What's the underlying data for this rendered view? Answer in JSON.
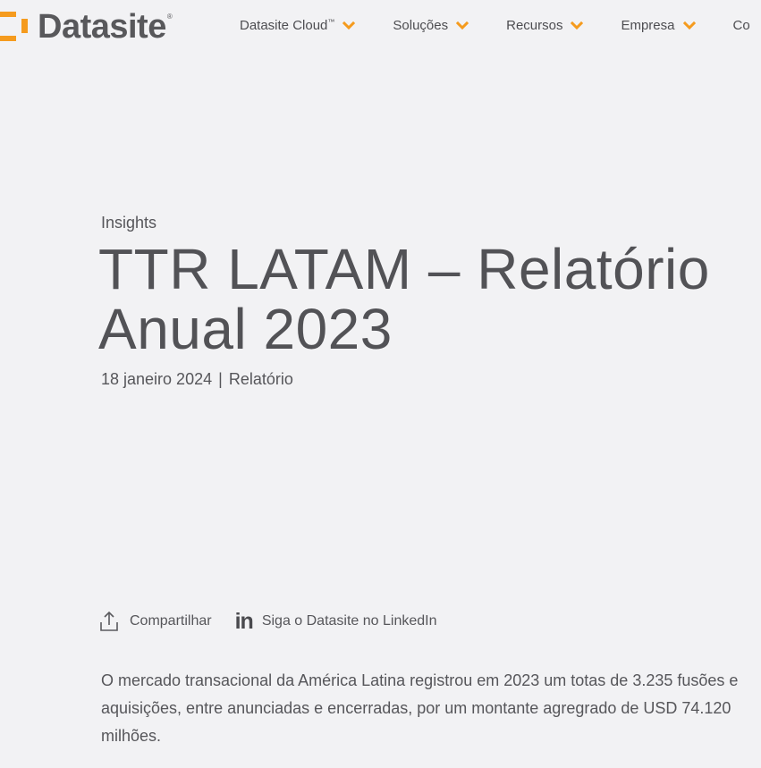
{
  "header": {
    "logo_text": "Datasite",
    "logo_reg": "®",
    "nav": [
      {
        "label": "Datasite Cloud",
        "suffix": "™"
      },
      {
        "label": "Soluções",
        "suffix": ""
      },
      {
        "label": "Recursos",
        "suffix": ""
      },
      {
        "label": "Empresa",
        "suffix": ""
      },
      {
        "label": "Co",
        "suffix": ""
      }
    ],
    "accent_color": "#f59b1e"
  },
  "hero": {
    "eyebrow": "Insights",
    "title_line1": "TTR LATAM – Relatório",
    "title_line2": "Anual 2023",
    "date": "18 janeiro 2024",
    "separator": "|",
    "type": "Relatório"
  },
  "share": {
    "share_label": "Compartilhar",
    "share_icon": "share-upload-icon",
    "linkedin_label": "Siga o Datasite no LinkedIn",
    "linkedin_icon_text": "in"
  },
  "body": {
    "lead": "O mercado transacional da América Latina registrou em 2023 um totas de 3.235 fusões e aquisições, entre anunciadas e encerradas, por um montante agregrado de USD 74.120 milhões."
  }
}
